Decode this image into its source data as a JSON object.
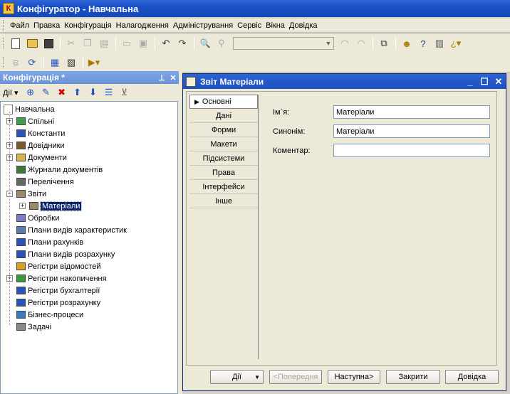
{
  "app": {
    "title": "Конфігуратор - Навчальна"
  },
  "menu": [
    "Файл",
    "Правка",
    "Конфігурація",
    "Налагодження",
    "Адміністрування",
    "Сервіс",
    "Вікна",
    "Довідка"
  ],
  "panel": {
    "title": "Конфігурація *",
    "actions_label": "Дії",
    "tree": {
      "root": "Навчальна",
      "items": [
        {
          "label": "Спільні",
          "expander": "+",
          "icon": "common-icon"
        },
        {
          "label": "Константи",
          "expander": "",
          "icon": "constants-icon"
        },
        {
          "label": "Довідники",
          "expander": "+",
          "icon": "catalogs-icon"
        },
        {
          "label": "Документи",
          "expander": "+",
          "icon": "documents-icon"
        },
        {
          "label": "Журнали документів",
          "expander": "",
          "icon": "journals-icon"
        },
        {
          "label": "Перелічення",
          "expander": "",
          "icon": "enums-icon"
        },
        {
          "label": "Звіти",
          "expander": "−",
          "icon": "reports-icon"
        },
        {
          "label": "Матеріали",
          "expander": "+",
          "icon": "report-item-icon",
          "selected": true,
          "child": true
        },
        {
          "label": "Обробки",
          "expander": "",
          "icon": "processing-icon"
        },
        {
          "label": "Плани видів характеристик",
          "expander": "",
          "icon": "char-types-icon"
        },
        {
          "label": "Плани рахунків",
          "expander": "",
          "icon": "accounts-icon"
        },
        {
          "label": "Плани видів розрахунку",
          "expander": "",
          "icon": "calc-types-icon"
        },
        {
          "label": "Регістри відомостей",
          "expander": "",
          "icon": "info-registers-icon"
        },
        {
          "label": "Регістри накопичення",
          "expander": "+",
          "icon": "accum-registers-icon"
        },
        {
          "label": "Регістри бухгалтерії",
          "expander": "",
          "icon": "acc-registers-icon"
        },
        {
          "label": "Регістри розрахунку",
          "expander": "",
          "icon": "calc-registers-icon"
        },
        {
          "label": "Бізнес-процеси",
          "expander": "",
          "icon": "business-process-icon"
        },
        {
          "label": "Задачі",
          "expander": "",
          "icon": "tasks-icon"
        }
      ]
    }
  },
  "document": {
    "title": "Звіт Матеріали",
    "tabs": [
      "Основні",
      "Дані",
      "Форми",
      "Макети",
      "Підсистеми",
      "Права",
      "Інтерфейси",
      "Інше"
    ],
    "fields": [
      {
        "label": "Ім`я:",
        "value": "Матеріали"
      },
      {
        "label": "Синонім:",
        "value": "Матеріали"
      },
      {
        "label": "Коментар:",
        "value": ""
      }
    ],
    "buttons": {
      "actions": "Дії",
      "prev": "<Попередня",
      "next": "Наступна>",
      "close": "Закрити",
      "help": "Довідка"
    }
  }
}
